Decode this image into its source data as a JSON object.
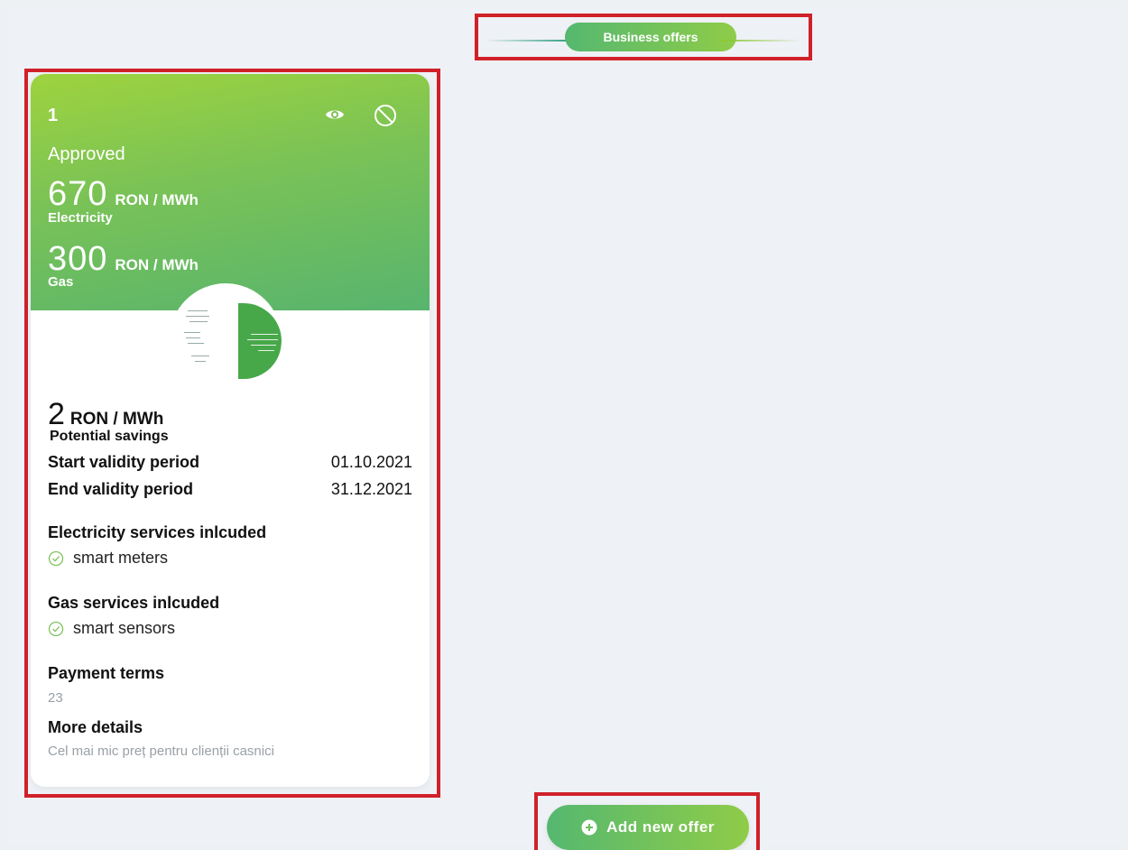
{
  "header": {
    "title": "Business offers"
  },
  "offer": {
    "number": "1",
    "status": "Approved",
    "electricity": {
      "price": "670",
      "unit": "RON / MWh",
      "label": "Electricity"
    },
    "gas": {
      "price": "300",
      "unit": "RON / MWh",
      "label": "Gas"
    },
    "savings": {
      "value": "2",
      "unit": "RON / MWh",
      "label": "Potential savings"
    },
    "start_validity": {
      "label": "Start validity period",
      "value": "01.10.2021"
    },
    "end_validity": {
      "label": "End validity period",
      "value": "31.12.2021"
    },
    "electricity_services": {
      "title": "Electricity services inlcuded",
      "items": [
        "smart meters"
      ]
    },
    "gas_services": {
      "title": "Gas services inlcuded",
      "items": [
        "smart sensors"
      ]
    },
    "payment_terms": {
      "title": "Payment terms",
      "value": "23"
    },
    "more_details": {
      "title": "More details",
      "value": "Cel mai mic preț pentru clienții casnici"
    }
  },
  "actions": {
    "add_offer_label": "Add new offer"
  },
  "colors": {
    "green_start": "#55b870",
    "green_end": "#8fcc48",
    "highlight": "#d0212a"
  },
  "icons": {
    "view": "eye-icon",
    "disable": "block-icon",
    "check": "check-circle-icon",
    "add": "plus-circle-icon"
  }
}
